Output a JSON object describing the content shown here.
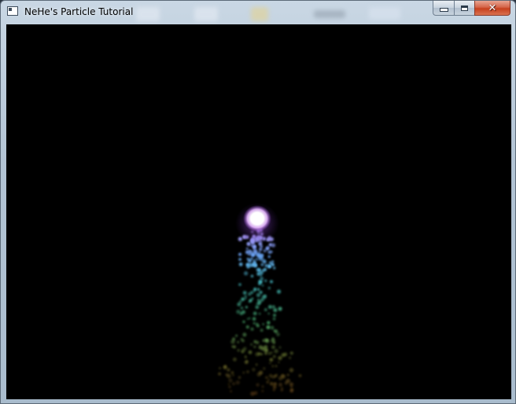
{
  "window": {
    "title": "NeHe's Particle Tutorial"
  },
  "caption_buttons": {
    "minimize": "minimize-icon",
    "maximize": "maximize-icon",
    "close": "close-icon"
  },
  "colors": {
    "client_background": "#000000",
    "core_glow": "#ffffff",
    "core_tint": "#d9a9ff",
    "close_button": "#c7401d"
  }
}
